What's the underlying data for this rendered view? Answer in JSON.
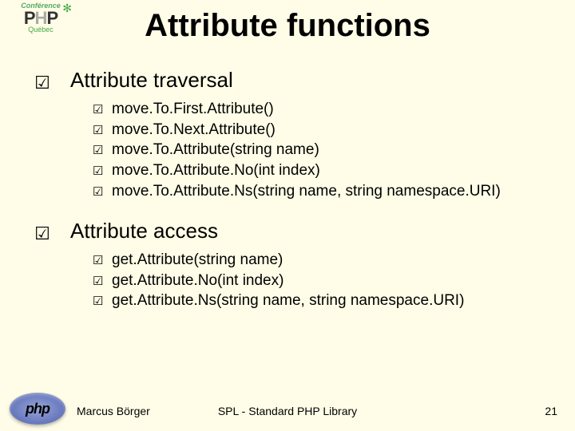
{
  "logo": {
    "conference": "Conférence",
    "brand": "PHP",
    "region": "Québec"
  },
  "title": "Attribute functions",
  "sections": [
    {
      "heading": "Attribute traversal",
      "items": [
        "move.To.First.Attribute()",
        "move.To.Next.Attribute()",
        "move.To.Attribute(string name)",
        "move.To.Attribute.No(int index)",
        "move.To.Attribute.Ns(string name, string namespace.URI)"
      ]
    },
    {
      "heading": "Attribute access",
      "items": [
        "get.Attribute(string name)",
        "get.Attribute.No(int index)",
        "get.Attribute.Ns(string name, string namespace.URI)"
      ]
    }
  ],
  "footer": {
    "author": "Marcus Börger",
    "center": "SPL - Standard PHP Library",
    "page": "21"
  },
  "phpLogo": "php"
}
